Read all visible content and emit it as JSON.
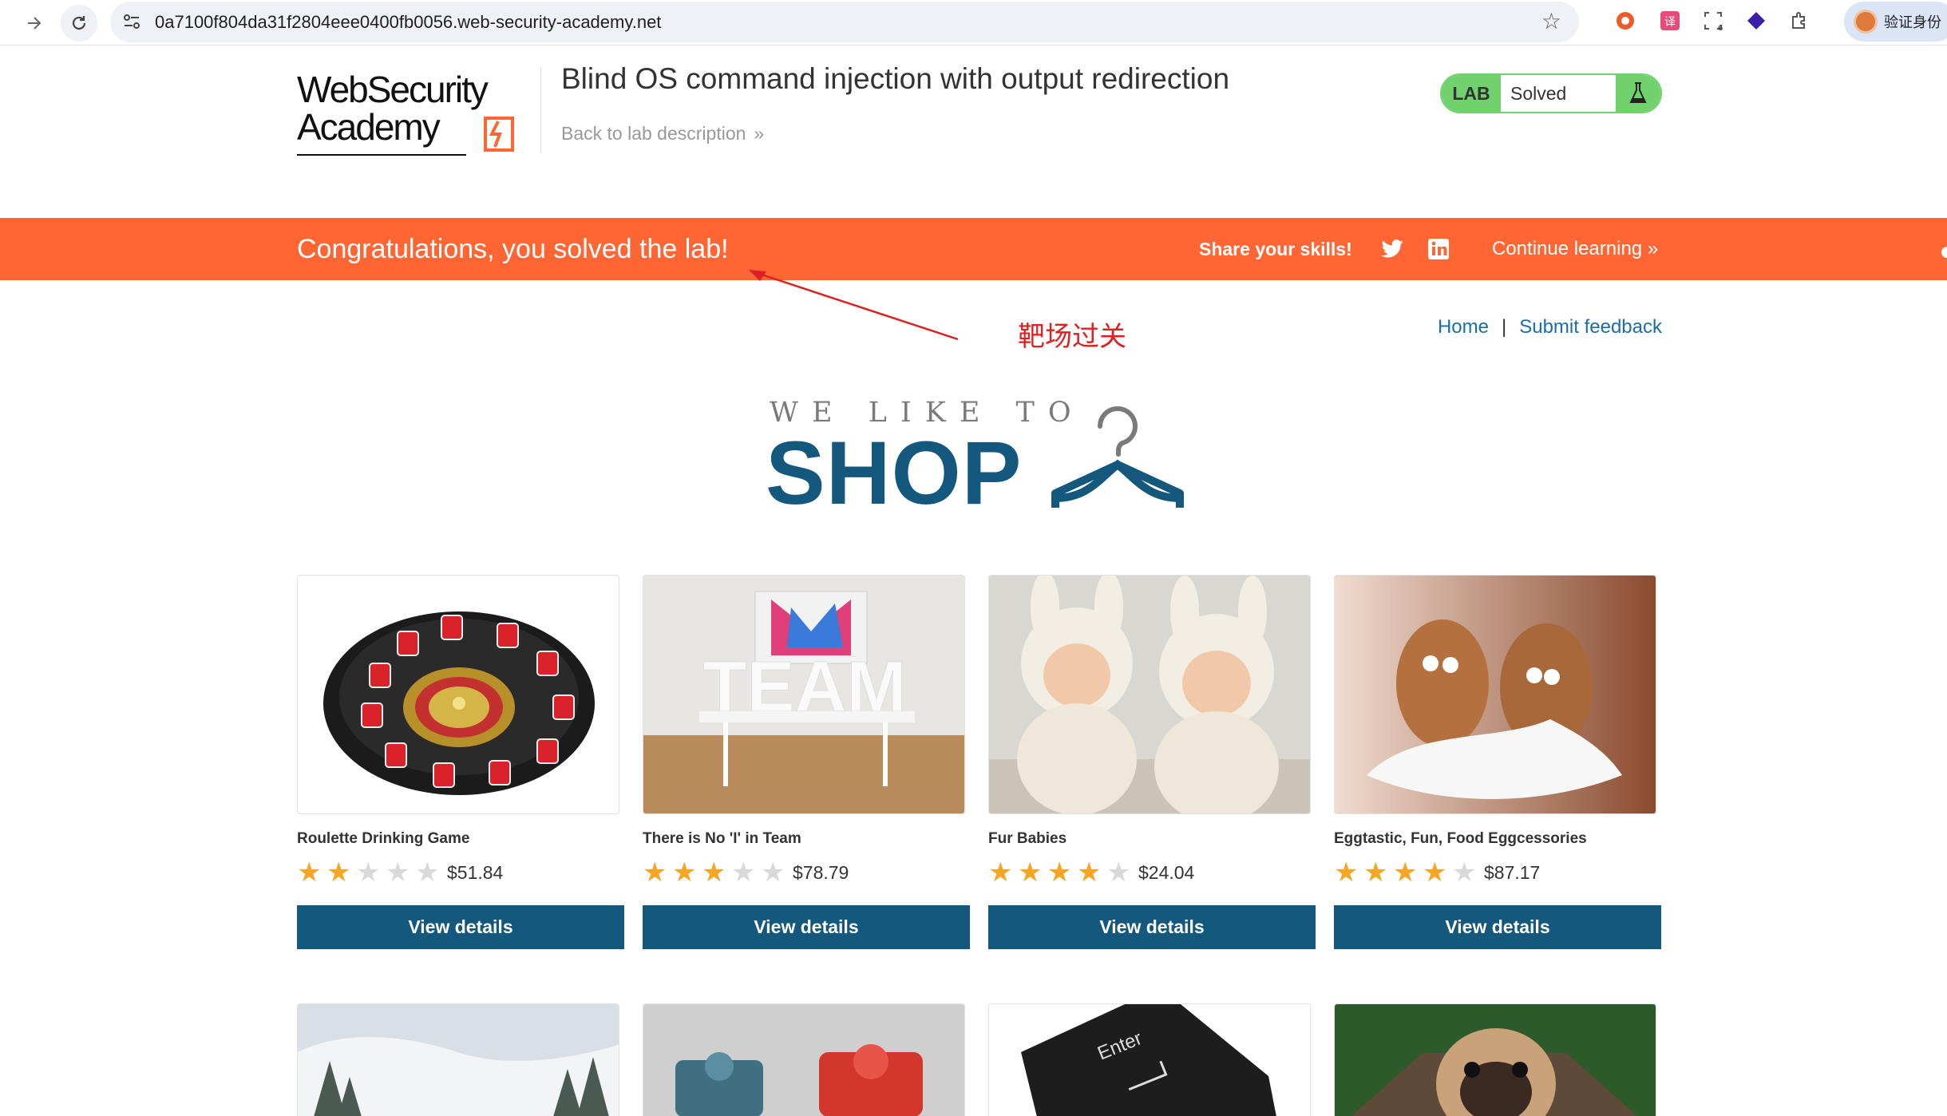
{
  "browser": {
    "url": "0a7100f804da31f2804eee0400fb0056.web-security-academy.net",
    "profile_label": "验证身份"
  },
  "lab": {
    "title": "Blind OS command injection with output redirection",
    "back_link": "Back to lab description",
    "back_chevron": "»",
    "status_tag": "LAB",
    "status": "Solved",
    "logo_line1": "WebSecurity",
    "logo_line2": "Academy"
  },
  "banner": {
    "message": "Congratulations, you solved the lab!",
    "share": "Share your skills!",
    "continue": "Continue learning",
    "continue_chevron": "»",
    "color": "#ff6633"
  },
  "annotation": {
    "text": "靶场过关",
    "color": "#e02020"
  },
  "top_links": {
    "home": "Home",
    "separator": "|",
    "feedback": "Submit feedback"
  },
  "hero": {
    "line1": "WE LIKE TO",
    "line2": "SHOP"
  },
  "products": [
    {
      "name": "Roulette Drinking Game",
      "rating": 2,
      "price": "$51.84",
      "button": "View details"
    },
    {
      "name": "There is No 'I' in Team",
      "rating": 3,
      "price": "$78.79",
      "button": "View details"
    },
    {
      "name": "Fur Babies",
      "rating": 4,
      "price": "$24.04",
      "button": "View details"
    },
    {
      "name": "Eggtastic, Fun, Food Eggcessories",
      "rating": 4,
      "price": "$87.17",
      "button": "View details"
    }
  ],
  "colors": {
    "accent": "#15587e",
    "lab_green": "#70d16d",
    "star_on": "#f5a623",
    "star_off": "#d9d9d9",
    "link": "#1a6ea9"
  }
}
